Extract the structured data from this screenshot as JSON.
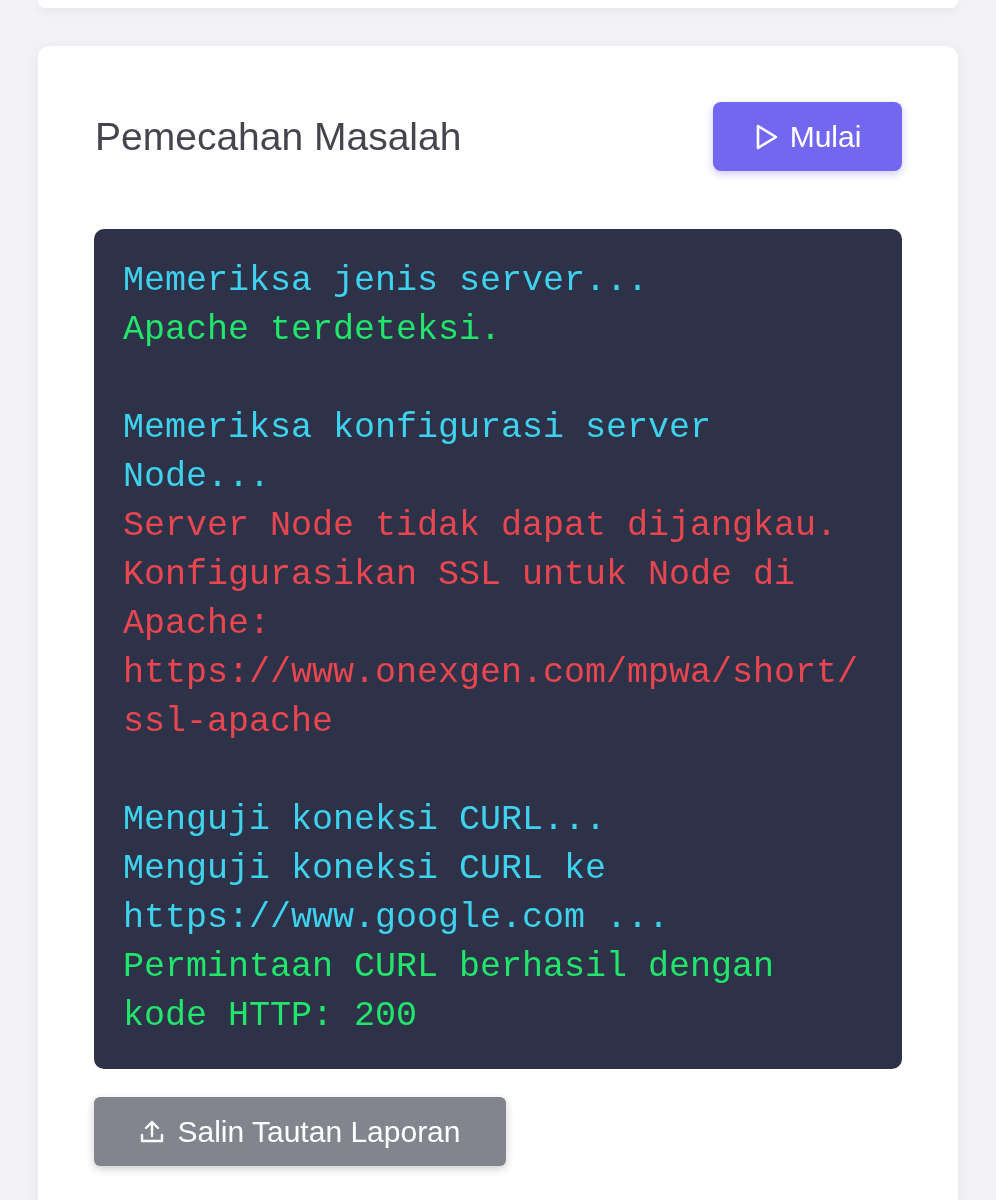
{
  "card": {
    "title": "Pemecahan Masalah",
    "start_button": {
      "label": "Mulai"
    },
    "console": {
      "blocks": [
        {
          "lines": [
            {
              "kind": "info",
              "text": "Memeriksa jenis server..."
            },
            {
              "kind": "success",
              "text": "Apache terdeteksi."
            }
          ]
        },
        {
          "lines": [
            {
              "kind": "info",
              "text": "Memeriksa konfigurasi server Node..."
            },
            {
              "kind": "error",
              "text": "Server Node tidak dapat dijangkau."
            },
            {
              "kind": "error",
              "text": "Konfigurasikan SSL untuk Node di Apache: https://www.onexgen.com/mpwa/short/ssl-apache"
            }
          ]
        },
        {
          "lines": [
            {
              "kind": "info",
              "text": "Menguji koneksi CURL..."
            },
            {
              "kind": "info",
              "text": "Menguji koneksi CURL ke https://www.google.com ..."
            },
            {
              "kind": "success",
              "text": "Permintaan CURL berhasil dengan kode HTTP: 200"
            }
          ]
        }
      ]
    },
    "copy_button": {
      "label": "Salin Tautan Laporan"
    }
  }
}
